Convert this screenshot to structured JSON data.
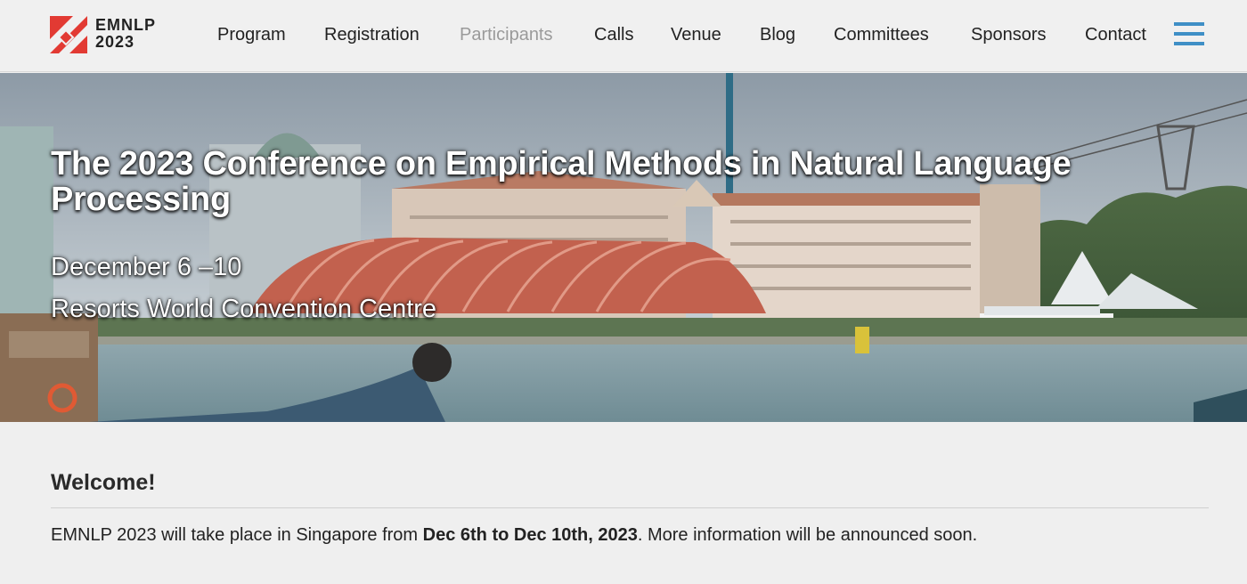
{
  "header": {
    "logo": {
      "line1": "EMNLP",
      "line2": "2023"
    },
    "nav": [
      {
        "label": "Program",
        "active": false
      },
      {
        "label": "Registration",
        "active": false
      },
      {
        "label": "Participants",
        "active": true
      },
      {
        "label": "Calls",
        "active": false
      },
      {
        "label": "Venue",
        "active": false
      },
      {
        "label": "Blog",
        "active": false
      },
      {
        "label": "Committees",
        "active": false
      },
      {
        "label": "Sponsors",
        "active": false
      },
      {
        "label": "Contact",
        "active": false
      }
    ],
    "menu_icon": "hamburger-menu-icon"
  },
  "hero": {
    "title": "The 2023 Conference on Empirical Methods in Natural Language Processing",
    "date": "December 6 –10",
    "venue": "Resorts World Convention Centre"
  },
  "welcome": {
    "heading": "Welcome!",
    "text_before": "EMNLP 2023 will take place in Singapore from ",
    "text_bold": "Dec 6th to Dec 10th, 2023",
    "text_after": ". More information will be announced soon."
  },
  "colors": {
    "logo_red": "#e23a33",
    "menu_blue": "#3f8fc6",
    "muted_nav": "#9a9a9a",
    "page_bg": "#efefef"
  }
}
